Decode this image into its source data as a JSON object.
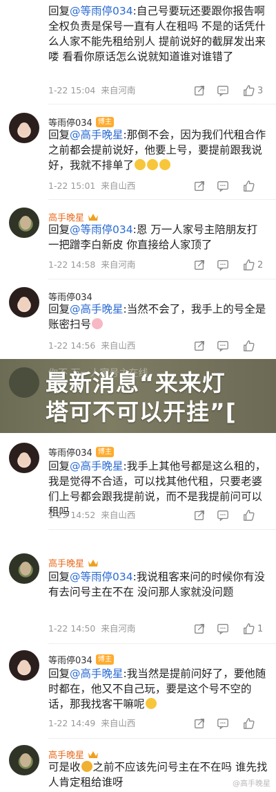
{
  "comments": [
    {
      "user": "",
      "reply_prefix": "回复",
      "mention": "@等雨停034",
      "text": ":自己号要玩还要跟你报告啊 全权负责是保号一直有人在租吗 不是的话凭什么人家不能先租给别人 提前说好的截屏发出来喽 看看你原话怎么说就知道谁对谁错了",
      "time": "1-22 15:04",
      "location": "来自河南",
      "likes": "3"
    },
    {
      "user": "等雨停034",
      "badge": "博主",
      "reply_prefix": "回复",
      "mention": "@高手晚星",
      "text": ":那倒不会，因为我们代租合作之前都会提前说好，他要上号，要提前跟我说好，我就不排单了",
      "time": "1-22 15:01",
      "location": "来自山西",
      "likes": ""
    },
    {
      "user": "高手晚星",
      "reply_prefix": "回复",
      "mention": "@等雨停034",
      "text": ":恩 万一人家号主陪朋友打一把蹭李白新皮 你直接给人家顶了",
      "time": "1-22 14:58",
      "location": "来自河南",
      "likes": "2"
    },
    {
      "user": "等雨停034",
      "reply_prefix": "回复",
      "mention": "@高手晚星",
      "text": ":当然不会了，我手上的号全是账密扫号",
      "time": "1-22 14:56",
      "location": "来自山西",
      "likes": ""
    },
    {
      "user": "等雨停034",
      "badge": "博主",
      "reply_prefix": "回复",
      "mention": "@高手晚星",
      "text": ":我手上其他号都是这么租的，我是觉得不合适，可以找其他代租，只要老婆们上号都会跟我提前说，而不是我提前问可以租吗",
      "time": "1-22 14:52",
      "location": "来自山西",
      "likes": ""
    },
    {
      "user": "高手晚星",
      "reply_prefix": "回复",
      "mention": "@等雨停034",
      "text": ":我说租客来问的时候你有没有去问号主在不在 没问那人家就没问题",
      "time": "1-22 14:50",
      "location": "来自河南",
      "likes": "1"
    },
    {
      "user": "等雨停034",
      "badge": "博主",
      "reply_prefix": "回复",
      "mention": "@高手晚星",
      "text": ":我当然是提前问好了，要他随时都在，他又不自己玩，要是这个号不空的话，那我找客干嘛呢",
      "time": "1-22 14:49",
      "location": "来自山西",
      "likes": ""
    },
    {
      "user": "高手晚星",
      "text_a": "可是收",
      "text_b": "之前不应该先问号主在不在吗 谁先找人肯定租给谁呀"
    }
  ],
  "banner": {
    "title_line1": "最新消息“来来灯",
    "title_line2": "塔可不可以开挂”[",
    "ghost_text": "你不 万一人家号主在线"
  },
  "watermark": "@高手晚星",
  "colors": {
    "mention": "#2b6bd3",
    "orange_name": "#e86b1f",
    "meta": "#999999"
  },
  "icons": [
    "share-icon",
    "comment-icon",
    "like-icon",
    "crown-icon"
  ]
}
